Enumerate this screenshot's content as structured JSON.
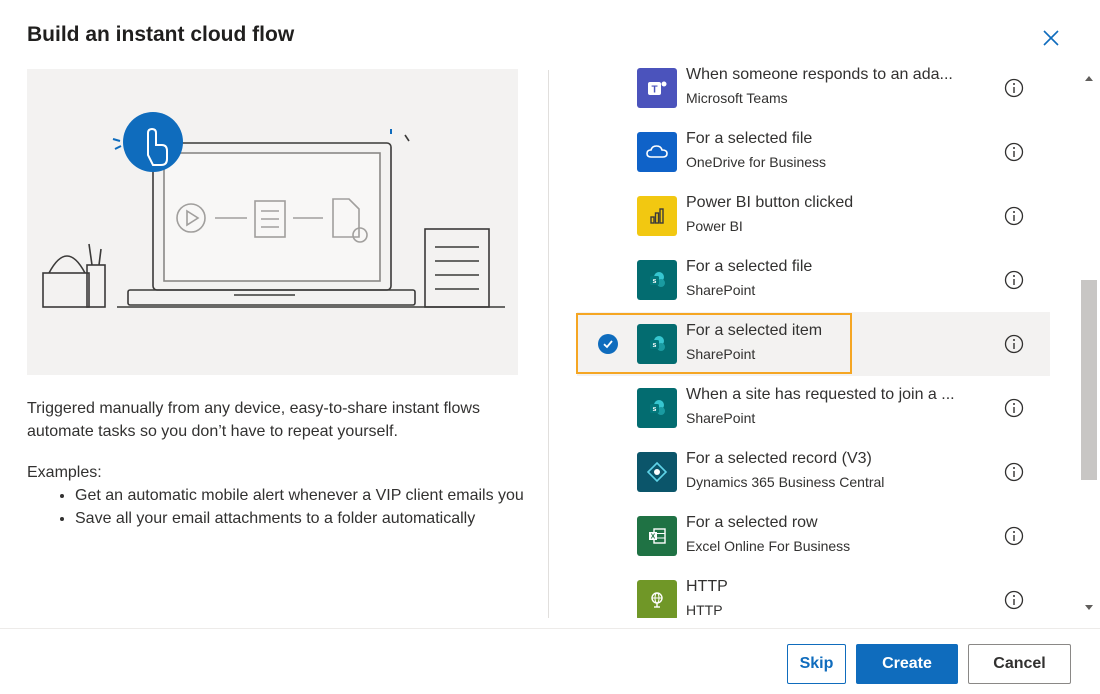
{
  "dialog": {
    "title": "Build an instant cloud flow"
  },
  "left": {
    "description": "Triggered manually from any device, easy-to-share instant flows automate tasks so you don’t have to repeat yourself.",
    "examples_label": "Examples:",
    "examples": [
      "Get an automatic mobile alert whenever a VIP client emails you",
      "Save all your email attachments to a folder automatically"
    ]
  },
  "triggers": [
    {
      "title": "When someone responds to an ada...",
      "connector": "Microsoft Teams",
      "icon": "teams-icon",
      "color": "#4b53bc",
      "selected": false
    },
    {
      "title": "For a selected file",
      "connector": "OneDrive for Business",
      "icon": "onedrive-icon",
      "color": "#0f62c8",
      "selected": false
    },
    {
      "title": "Power BI button clicked",
      "connector": "Power BI",
      "icon": "powerbi-icon",
      "color": "#f2c811",
      "selected": false
    },
    {
      "title": "For a selected file",
      "connector": "SharePoint",
      "icon": "sharepoint-icon",
      "color": "#036c70",
      "selected": false
    },
    {
      "title": "For a selected item",
      "connector": "SharePoint",
      "icon": "sharepoint-icon",
      "color": "#036c70",
      "selected": true
    },
    {
      "title": "When a site has requested to join a ...",
      "connector": "SharePoint",
      "icon": "sharepoint-icon",
      "color": "#036c70",
      "selected": false
    },
    {
      "title": "For a selected record (V3)",
      "connector": "Dynamics 365 Business Central",
      "icon": "dynamics-icon",
      "color": "#0b556a",
      "selected": false
    },
    {
      "title": "For a selected row",
      "connector": "Excel Online For Business",
      "icon": "excel-icon",
      "color": "#1f7244",
      "selected": false
    },
    {
      "title": "HTTP",
      "connector": "HTTP",
      "icon": "http-icon",
      "color": "#709727",
      "selected": false
    }
  ],
  "footer": {
    "skip_label": "Skip",
    "create_label": "Create",
    "cancel_label": "Cancel"
  },
  "colors": {
    "primary": "#0f6cbd",
    "highlight": "#f5a623"
  }
}
